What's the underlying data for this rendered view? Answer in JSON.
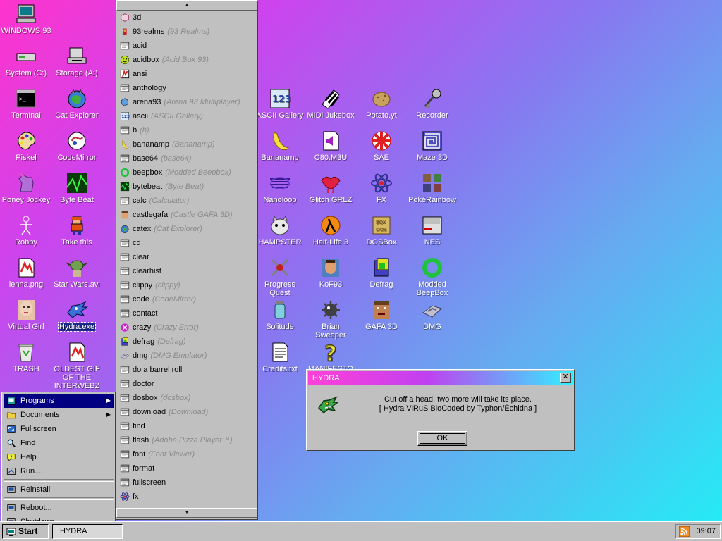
{
  "desktop_icons": [
    {
      "id": "windows93",
      "label": "WINDOWS 93",
      "icon": "computer-icon"
    },
    {
      "id": "system",
      "label": "System (C:)",
      "icon": "hard-drive-icon"
    },
    {
      "id": "storage",
      "label": "Storage (A:)",
      "icon": "floppy-drive-icon"
    },
    {
      "id": "terminal",
      "label": "Terminal",
      "icon": "terminal-icon"
    },
    {
      "id": "cat-explorer",
      "label": "Cat Explorer",
      "icon": "cat-globe-icon"
    },
    {
      "id": "piskel",
      "label": "Piskel",
      "icon": "palette-icon"
    },
    {
      "id": "codemirror",
      "label": "CodeMirror",
      "icon": "codemirror-icon"
    },
    {
      "id": "poney-jockey",
      "label": "Poney Jockey",
      "icon": "pony-icon"
    },
    {
      "id": "byte-beat",
      "label": "Byte Beat",
      "icon": "waveform-icon"
    },
    {
      "id": "robby",
      "label": "Robby",
      "icon": "stick-figure-icon"
    },
    {
      "id": "take-this",
      "label": "Take this",
      "icon": "pixel-man-icon"
    },
    {
      "id": "lenna",
      "label": "lenna.png",
      "icon": "image-file-icon"
    },
    {
      "id": "star-wars",
      "label": "Star Wars.avi",
      "icon": "yoda-icon"
    },
    {
      "id": "virtual-girl",
      "label": "Virtual Girl",
      "icon": "face-icon"
    },
    {
      "id": "hydra",
      "label": "Hydra.exe",
      "icon": "hydra-icon"
    },
    {
      "id": "trash",
      "label": "TRASH",
      "icon": "trash-icon"
    },
    {
      "id": "oldest-gif",
      "label": "OLDEST GIF OF THE INTERWEBZ",
      "icon": "gif-file-icon"
    },
    {
      "id": "ascii-gallery",
      "label": "ASCII Gallery",
      "icon": "ascii-123-icon"
    },
    {
      "id": "midi-jukebox",
      "label": "MIDI Jukebox",
      "icon": "piano-keys-icon"
    },
    {
      "id": "potato",
      "label": "Potato.yt",
      "icon": "potato-icon"
    },
    {
      "id": "recorder",
      "label": "Recorder",
      "icon": "microphone-icon"
    },
    {
      "id": "bananamp",
      "label": "Bananamp",
      "icon": "banana-icon"
    },
    {
      "id": "c80",
      "label": "C80.M3U",
      "icon": "audio-file-icon"
    },
    {
      "id": "sae",
      "label": "SAE",
      "icon": "checker-ball-icon"
    },
    {
      "id": "maze3d",
      "label": "Maze 3D",
      "icon": "maze-icon"
    },
    {
      "id": "nanoloop",
      "label": "Nanoloop",
      "icon": "nanoloop-icon"
    },
    {
      "id": "glitch",
      "label": "Glitch GRLZ",
      "icon": "lips-icon"
    },
    {
      "id": "fx",
      "label": "FX",
      "icon": "atom-icon"
    },
    {
      "id": "pokerainbow",
      "label": "PokéRainbow",
      "icon": "pokemon-icon"
    },
    {
      "id": "hampster",
      "label": "HAMPSTER",
      "icon": "hamster-icon"
    },
    {
      "id": "halflife",
      "label": "Half-Life 3",
      "icon": "lambda-icon"
    },
    {
      "id": "dosbox",
      "label": "DOSBox",
      "icon": "dosbox-icon"
    },
    {
      "id": "nes",
      "label": "NES",
      "icon": "nes-icon"
    },
    {
      "id": "progress-quest",
      "label": "Progress Quest",
      "icon": "swords-icon"
    },
    {
      "id": "kof93",
      "label": "KoF93",
      "icon": "fighter-icon"
    },
    {
      "id": "defrag",
      "label": "Defrag",
      "icon": "defrag-icon"
    },
    {
      "id": "modded-beepbox",
      "label": "Modded BeepBox",
      "icon": "ring-icon"
    },
    {
      "id": "solitude",
      "label": "Solitude",
      "icon": "jar-icon"
    },
    {
      "id": "brian-sweeper",
      "label": "Brian Sweeper",
      "icon": "mine-icon"
    },
    {
      "id": "gafa3d",
      "label": "GAFA 3D",
      "icon": "doom-face-icon"
    },
    {
      "id": "dmg",
      "label": "DMG",
      "icon": "gameboy-icon"
    },
    {
      "id": "credits",
      "label": "Credits.txt",
      "icon": "text-file-icon"
    },
    {
      "id": "manifesto",
      "label": "MANIFESTO",
      "icon": "question-mark-icon"
    }
  ],
  "start_menu": {
    "items": [
      {
        "label": "Programs",
        "icon": "programs-icon",
        "active": true,
        "submenu": true
      },
      {
        "label": "Documents",
        "icon": "folder-icon",
        "submenu": true
      },
      {
        "label": "Fullscreen",
        "icon": "fullscreen-icon"
      },
      {
        "label": "Find",
        "icon": "find-icon"
      },
      {
        "label": "Help",
        "icon": "help-icon"
      },
      {
        "label": "Run...",
        "icon": "run-icon"
      },
      {
        "separator": true
      },
      {
        "label": "Reinstall",
        "icon": "reinstall-icon"
      },
      {
        "separator": true
      },
      {
        "label": "Reboot...",
        "icon": "reboot-icon"
      },
      {
        "label": "Shutdown",
        "icon": "shutdown-icon"
      }
    ]
  },
  "programs": [
    {
      "cmd": "3d",
      "icon": "cube-icon"
    },
    {
      "cmd": "93realms",
      "alt": "(93 Realms)",
      "icon": "realms-icon"
    },
    {
      "cmd": "acid",
      "icon": "app-window-icon"
    },
    {
      "cmd": "acidbox",
      "alt": "(Acid Box 93)",
      "icon": "smiley-icon"
    },
    {
      "cmd": "ansi",
      "icon": "ansi-icon"
    },
    {
      "cmd": "anthology",
      "icon": "app-window-icon"
    },
    {
      "cmd": "arena93",
      "alt": "(Arena 93 Multiplayer)",
      "icon": "arena-icon"
    },
    {
      "cmd": "ascii",
      "alt": "(ASCII Gallery)",
      "icon": "ascii-123-icon"
    },
    {
      "cmd": "b",
      "alt": "(b)",
      "icon": "app-window-icon"
    },
    {
      "cmd": "bananamp",
      "alt": "(Bananamp)",
      "icon": "banana-icon"
    },
    {
      "cmd": "base64",
      "alt": "(base64)",
      "icon": "app-window-icon"
    },
    {
      "cmd": "beepbox",
      "alt": "(Modded Beepbox)",
      "icon": "ring-icon"
    },
    {
      "cmd": "bytebeat",
      "alt": "(Byte Beat)",
      "icon": "waveform-icon"
    },
    {
      "cmd": "calc",
      "alt": "(Calculator)",
      "icon": "app-window-icon"
    },
    {
      "cmd": "castlegafa",
      "alt": "(Castle GAFA 3D)",
      "icon": "castle-face-icon"
    },
    {
      "cmd": "catex",
      "alt": "(Cat Explorer)",
      "icon": "cat-globe-icon"
    },
    {
      "cmd": "cd",
      "icon": "app-window-icon"
    },
    {
      "cmd": "clear",
      "icon": "app-window-icon"
    },
    {
      "cmd": "clearhist",
      "icon": "app-window-icon"
    },
    {
      "cmd": "clippy",
      "alt": "(clippy)",
      "icon": "app-window-icon"
    },
    {
      "cmd": "code",
      "alt": "(CodeMirror)",
      "icon": "app-window-icon"
    },
    {
      "cmd": "contact",
      "icon": "app-window-icon"
    },
    {
      "cmd": "crazy",
      "alt": "(Crazy Error)",
      "icon": "error-icon"
    },
    {
      "cmd": "defrag",
      "alt": "(Defrag)",
      "icon": "defrag-icon"
    },
    {
      "cmd": "dmg",
      "alt": "(DMG Emulator)",
      "icon": "gameboy-icon"
    },
    {
      "cmd": "do a barrel roll",
      "icon": "app-window-icon"
    },
    {
      "cmd": "doctor",
      "icon": "app-window-icon"
    },
    {
      "cmd": "dosbox",
      "alt": "(dosbox)",
      "icon": "app-window-icon"
    },
    {
      "cmd": "download",
      "alt": "(Download)",
      "icon": "app-window-icon"
    },
    {
      "cmd": "find",
      "icon": "app-window-icon"
    },
    {
      "cmd": "flash",
      "alt": "(Adobe Pizza Player™)",
      "icon": "app-window-icon"
    },
    {
      "cmd": "font",
      "alt": "(Font Viewer)",
      "icon": "app-window-icon"
    },
    {
      "cmd": "format",
      "icon": "app-window-icon"
    },
    {
      "cmd": "fullscreen",
      "icon": "app-window-icon"
    },
    {
      "cmd": "fx",
      "icon": "atom-icon"
    }
  ],
  "dialog": {
    "title": "HYDRA",
    "line1": "Cut off a head, two more will take its place.",
    "line2": "[ Hydra ViRuS BioCoded by Typhon/Échidna ]",
    "ok": "OK"
  },
  "taskbar": {
    "start": "Start",
    "task": "HYDRA",
    "clock": "09:07"
  },
  "colors": {
    "window_face": "#c0c0c0",
    "selection": "#000080",
    "title_start": "#ff40d8",
    "title_end": "#30f0ff"
  }
}
